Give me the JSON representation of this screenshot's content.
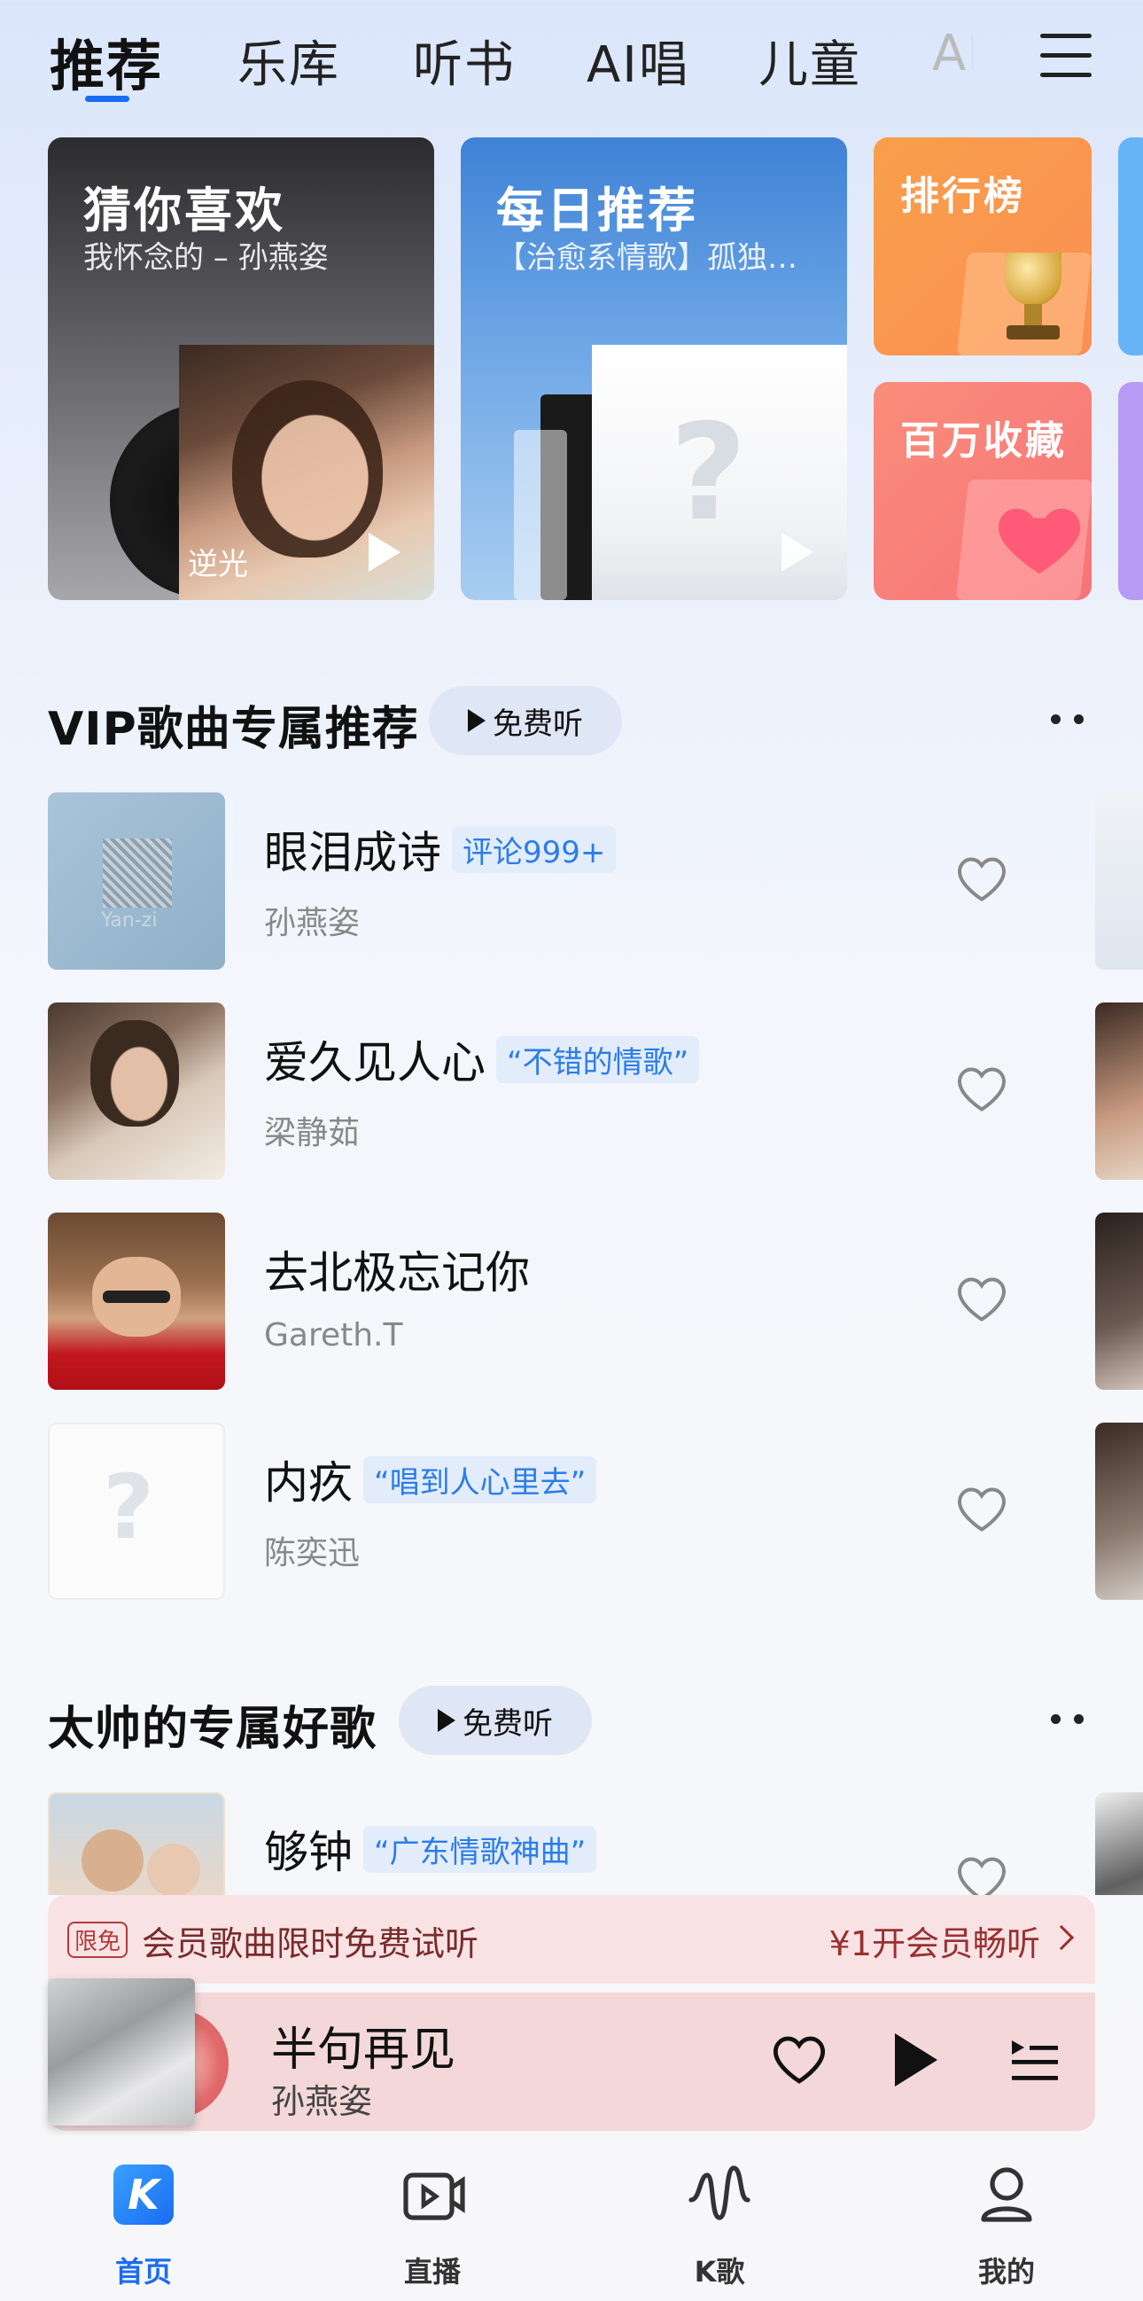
{
  "top_tabs": [
    {
      "label": "推荐"
    },
    {
      "label": "乐库"
    },
    {
      "label": "听书"
    },
    {
      "label": "AI唱"
    },
    {
      "label": "儿童"
    },
    {
      "label": "AI"
    }
  ],
  "cards": {
    "guess": {
      "title": "猜你喜欢",
      "subtitle": "我怀念的 – 孙燕姿",
      "album_text": "逆光"
    },
    "daily": {
      "title": "每日推荐",
      "subtitle": "【治愈系情歌】孤独…"
    },
    "rank": {
      "title": "排行榜"
    },
    "million": {
      "title": "百万收藏"
    }
  },
  "section_vip": {
    "title": "VIP歌曲专属推荐",
    "free_label": "免费听",
    "songs": [
      {
        "title": "眼泪成诗",
        "tag": "评论999+",
        "artist": "孙燕姿"
      },
      {
        "title": "爱久见人心",
        "tag": "“不错的情歌”",
        "artist": "梁静茹"
      },
      {
        "title": "去北极忘记你",
        "tag": "",
        "artist": "Gareth.T"
      },
      {
        "title": "内疚",
        "tag": "“唱到人心里去”",
        "artist": "陈奕迅"
      }
    ]
  },
  "section_taishuai": {
    "title": "太帅的专属好歌",
    "free_label": "免费听",
    "songs": [
      {
        "title": "够钟",
        "tag": "“广东情歌神曲”",
        "artist": ""
      }
    ]
  },
  "promo": {
    "badge": "限免",
    "text": "会员歌曲限时免费试听",
    "cta": "¥1开会员畅听"
  },
  "player": {
    "title": "半句再见",
    "artist": "孙燕姿"
  },
  "bottom_nav": [
    {
      "label": "首页",
      "icon": "k-logo-icon"
    },
    {
      "label": "直播",
      "icon": "live-video-icon"
    },
    {
      "label": "K歌",
      "icon": "mic-wave-icon"
    },
    {
      "label": "我的",
      "icon": "profile-icon"
    }
  ],
  "colors": {
    "accent": "#1a6cf2",
    "tag_blue": "#2b7de9"
  }
}
